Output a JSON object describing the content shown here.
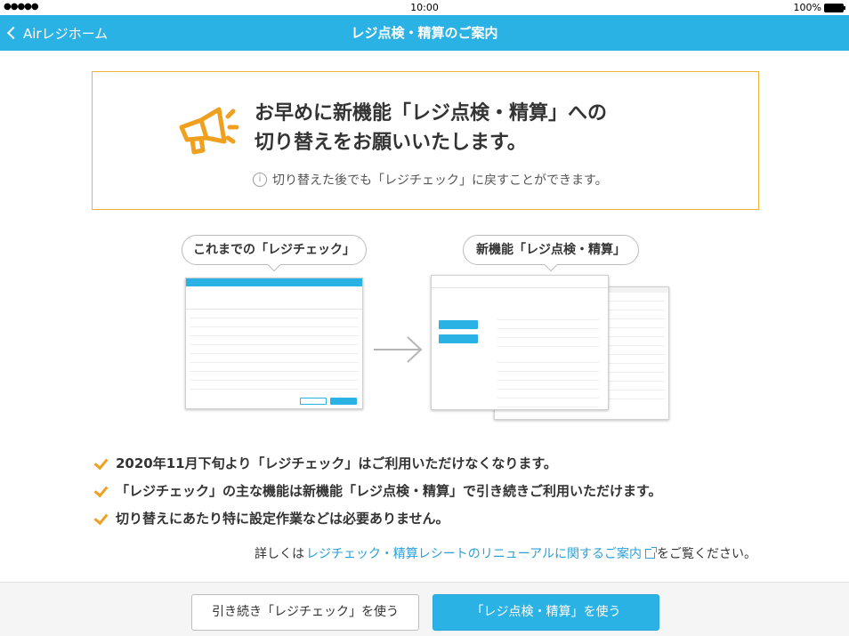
{
  "status_bar": {
    "signal": "●●●●●",
    "time": "10:00",
    "battery": "100%"
  },
  "nav": {
    "back_label": "Airレジホーム",
    "title": "レジ点検・精算のご案内"
  },
  "notice": {
    "title_line1": "お早めに新機能「レジ点検・精算」への",
    "title_line2": "切り替えをお願いいたします。",
    "note": "切り替えた後でも「レジチェック」に戻すことができます。",
    "info_icon": "i",
    "accent_color": "#f0b33a"
  },
  "comparison": {
    "old_label": "これまでの「レジチェック」",
    "new_label": "新機能「レジ点検・精算」"
  },
  "checklist": [
    "2020年11月下旬より「レジチェック」はご利用いただけなくなります。",
    "「レジチェック」の主な機能は新機能「レジ点検・精算」で引き続きご利用いただけます。",
    "切り替えにあたり特に設定作業などは必要ありません。"
  ],
  "details": {
    "prefix": "詳しくは",
    "link": "レジチェック・精算レシートのリニューアルに関するご案内",
    "suffix": "をご覧ください。"
  },
  "footer": {
    "secondary_button": "引き続き「レジチェック」を使う",
    "primary_button": "「レジ点検・精算」を使う"
  },
  "colors": {
    "brand": "#2ab2e4",
    "check": "#f0a020",
    "link": "#2a9fd8"
  }
}
